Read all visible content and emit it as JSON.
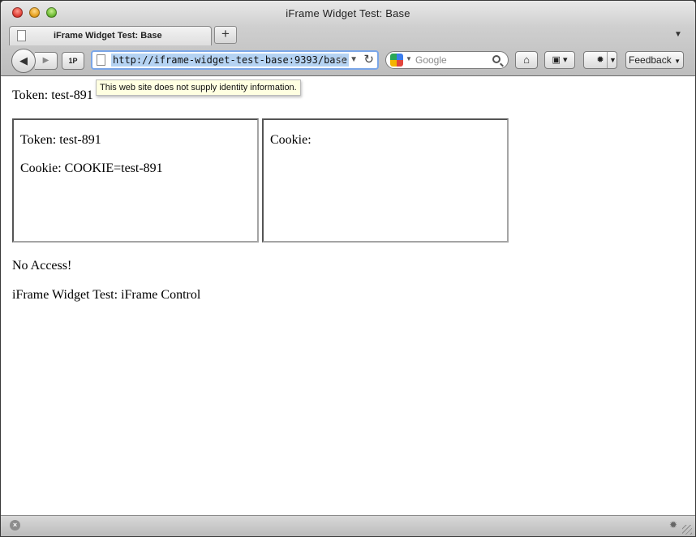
{
  "window": {
    "title": "iFrame Widget Test: Base"
  },
  "tabs": [
    {
      "label": "iFrame Widget Test: Base"
    }
  ],
  "toolbar": {
    "new_tab_label": "+",
    "onepassword_label": "1P",
    "url": "http://iframe-widget-test-base:9393/base",
    "search_placeholder": "Google",
    "feedback_label": "Feedback"
  },
  "tooltip": {
    "text": "This web site does not supply identity information."
  },
  "content": {
    "token_line": "Token: test-891",
    "iframe_left": {
      "token_line": "Token: test-891",
      "cookie_line": "Cookie: COOKIE=test-891"
    },
    "iframe_right": {
      "cookie_line": "Cookie:"
    },
    "no_access": "No Access!",
    "control_title": "iFrame Widget Test: iFrame Control"
  },
  "colors": {
    "url_highlight": "#b5d3f3",
    "url_focus_ring": "#7aa6e8",
    "tooltip_bg": "#ffffe1"
  },
  "icons": [
    "page-icon",
    "back-arrow-icon",
    "forward-arrow-icon",
    "star-icon",
    "reload-icon",
    "google-icon",
    "search-icon",
    "home-icon",
    "bookmarks-icon",
    "addon-icon",
    "stop-icon",
    "resize-grip-icon"
  ]
}
